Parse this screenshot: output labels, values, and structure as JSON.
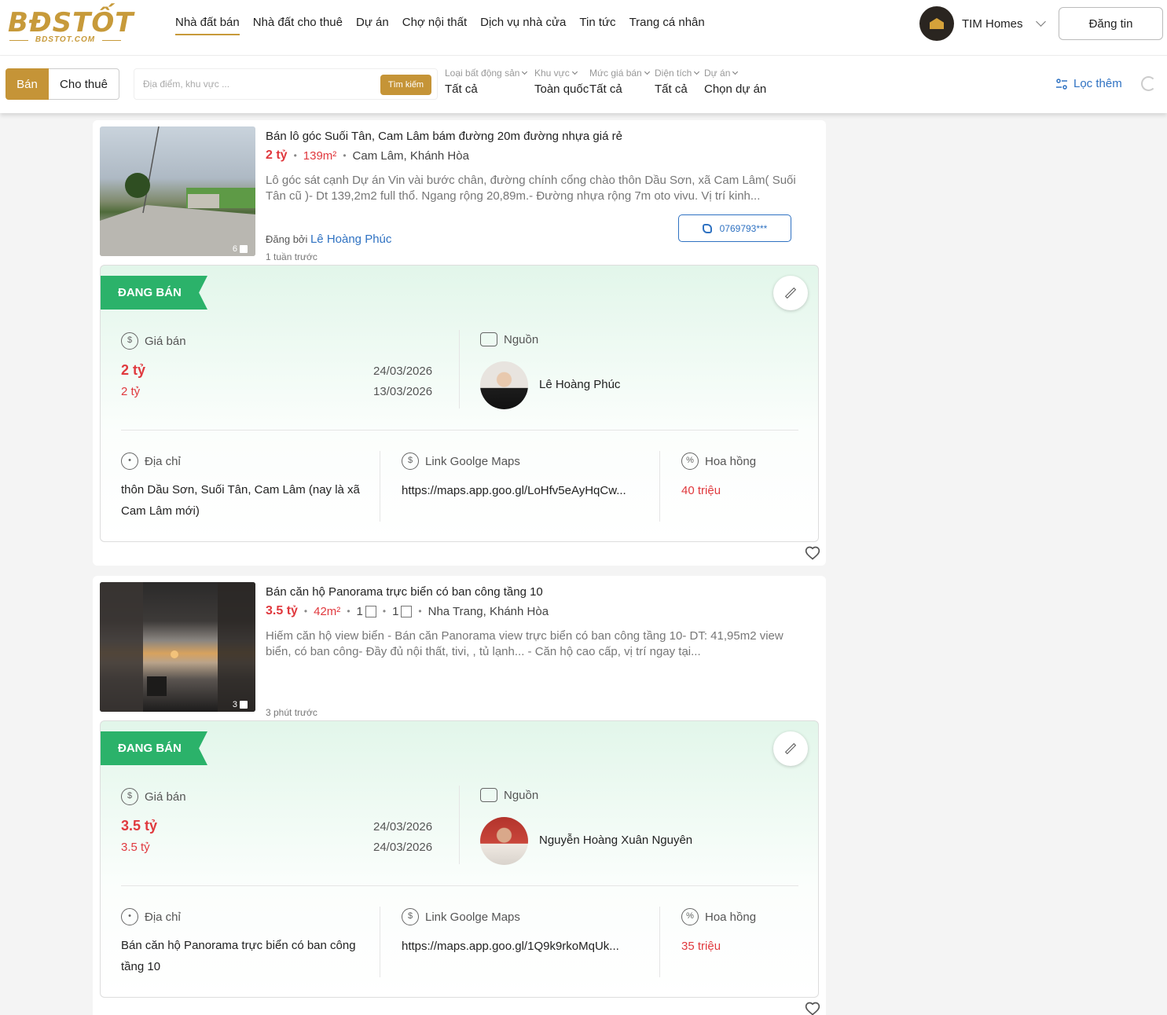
{
  "logo": {
    "big": "BĐSTỐT",
    "small": "BDSTOT.COM"
  },
  "nav": [
    "Nhà đất bán",
    "Nhà đất cho thuê",
    "Dự án",
    "Chợ nội thất",
    "Dịch vụ nhà cửa",
    "Tin tức",
    "Trang cá nhân"
  ],
  "account": {
    "name": "TIM Homes",
    "avatar_icon": "home-logo-icon"
  },
  "post_button": "Đăng tin",
  "segment": {
    "sell": "Bán",
    "rent": "Cho thuê"
  },
  "search": {
    "placeholder": "Địa điểm, khu vực ...",
    "button": "Tìm kiếm"
  },
  "filters": [
    {
      "label": "Loại bất động sản",
      "value": "Tất cả"
    },
    {
      "label": "Khu vực",
      "value": "Toàn quốc"
    },
    {
      "label": "Mức giá bán",
      "value": "Tất cả"
    },
    {
      "label": "Diện tích",
      "value": "Tất cả"
    },
    {
      "label": "Dự án",
      "value": "Chọn dự án"
    }
  ],
  "more_filters": "Lọc thêm",
  "labels": {
    "status": "ĐANG BÁN",
    "price": "Giá bán",
    "source": "Nguồn",
    "address": "Địa chỉ",
    "maps": "Link Goolge Maps",
    "commission": "Hoa hồng",
    "posted_by": "Đăng bởi"
  },
  "listings": [
    {
      "title": "Bán lô góc Suối Tân, Cam Lâm bám đường 20m đường nhựa giá rẻ",
      "price": "2 tỷ",
      "area": "139m²",
      "location": "Cam Lâm, Khánh Hòa",
      "photo_count": "6",
      "description": "Lô góc sát cạnh Dự án Vin vài bước chân, đường chính cổng chào thôn Dầu Sơn, xã Cam Lâm( Suối Tân cũ )- Dt 139,2m2 full thổ. Ngang rộng 20,89m.- Đường nhựa rộng 7m oto vivu. Vị trí kinh...",
      "poster": "Lê Hoàng Phúc",
      "phone": "0769793***",
      "time": "1 tuần trước",
      "price_main": "2 tỷ",
      "price_sub": "2 tỷ",
      "date1": "24/03/2026",
      "date2": "13/03/2026",
      "source_name": "Lê Hoàng Phúc",
      "address": "thôn Dầu Sơn, Suối Tân, Cam Lâm (nay là xã Cam Lâm mới)",
      "maps": "https://maps.app.goo.gl/LoHfv5eAyHqCw...",
      "commission": "40 triệu"
    },
    {
      "title": "Bán căn hộ Panorama trực biển có ban công tầng 10",
      "price": "3.5 tỷ",
      "area": "42m²",
      "beds": "1",
      "baths": "1",
      "location": "Nha Trang, Khánh Hòa",
      "photo_count": "3",
      "description": "Hiếm căn hộ view biển - Bán căn Panorama view trực biển có ban công tầng 10- DT: 41,95m2 view biển, có ban công- Đầy đủ nội thất, tivi, , tủ lạnh... - Căn hộ cao cấp, vị trí ngay tại...",
      "time": "3 phút trước",
      "price_main": "3.5 tỷ",
      "price_sub": "3.5 tỷ",
      "date1": "24/03/2026",
      "date2": "24/03/2026",
      "source_name": "Nguyễn Hoàng Xuân Nguyên",
      "address": "Bán căn hộ Panorama trực biển có ban công tầng 10",
      "maps": "https://maps.app.goo.gl/1Q9k9rkoMqUk...",
      "commission": "35 triệu"
    }
  ],
  "colors": {
    "brand": "#c59437",
    "accent_blue": "#2f72c2",
    "price_red": "#e0393e",
    "status_green": "#2bb26a"
  }
}
